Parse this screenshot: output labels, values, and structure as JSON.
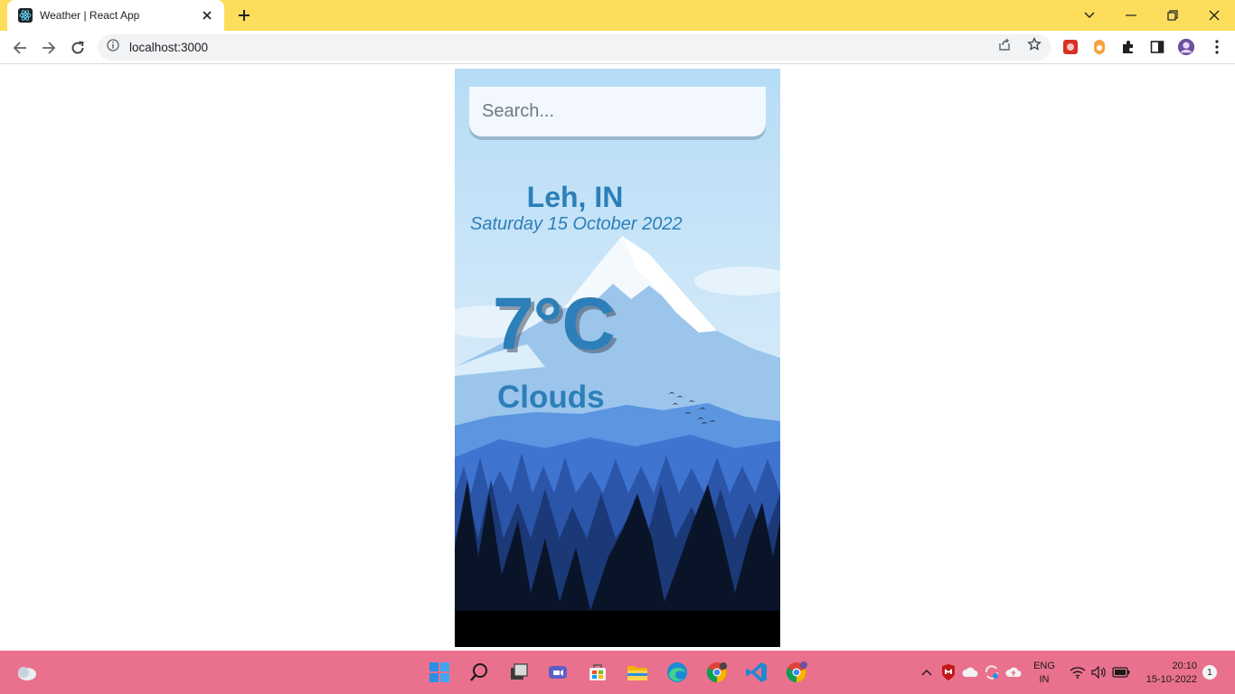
{
  "browser": {
    "tab_title": "Weather | React App",
    "url": "localhost:3000",
    "tab_strip_color": "#fddd5c"
  },
  "app": {
    "search_placeholder": "Search...",
    "location": "Leh, IN",
    "date": "Saturday 15 October 2022",
    "temperature": "7°C",
    "condition": "Clouds",
    "text_color": "#2c7fb8"
  },
  "taskbar": {
    "color": "#ea718d",
    "language_line1": "ENG",
    "language_line2": "IN",
    "time": "20:10",
    "date": "15-10-2022",
    "notification_count": "1"
  }
}
